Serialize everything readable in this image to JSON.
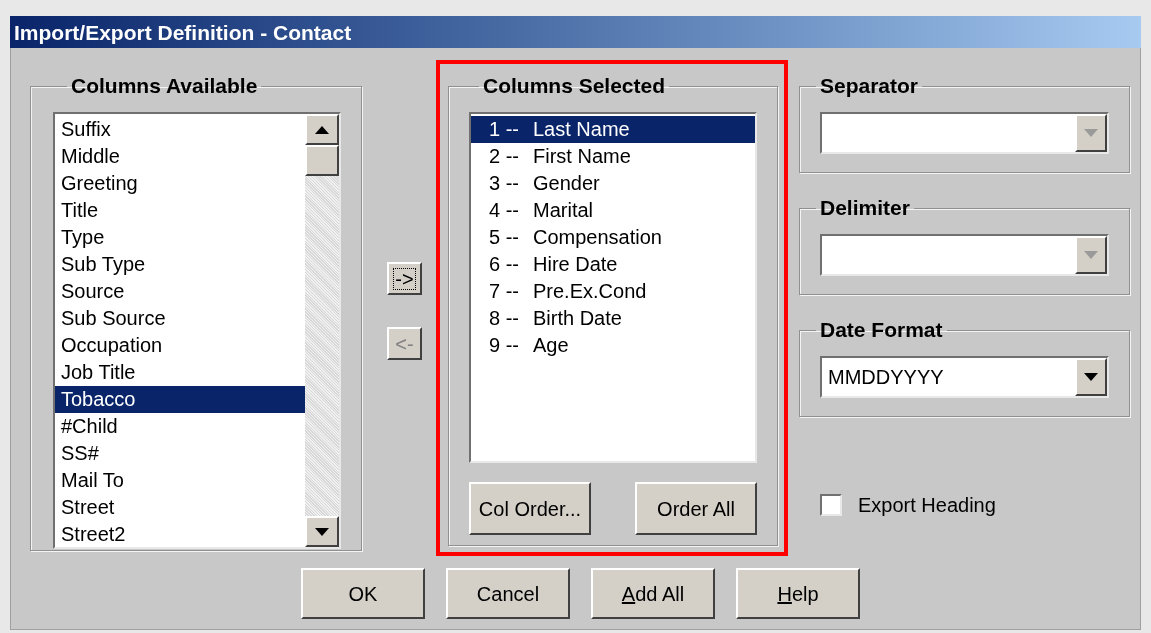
{
  "window": {
    "title": "Import/Export Definition - Contact"
  },
  "columns_available": {
    "title": "Columns Available",
    "items": [
      {
        "label": "Suffix",
        "selected": false
      },
      {
        "label": "Middle",
        "selected": false
      },
      {
        "label": "Greeting",
        "selected": false
      },
      {
        "label": "Title",
        "selected": false
      },
      {
        "label": "Type",
        "selected": false
      },
      {
        "label": "Sub Type",
        "selected": false
      },
      {
        "label": "Source",
        "selected": false
      },
      {
        "label": "Sub Source",
        "selected": false
      },
      {
        "label": "Occupation",
        "selected": false
      },
      {
        "label": "Job Title",
        "selected": false
      },
      {
        "label": "Tobacco",
        "selected": true
      },
      {
        "label": "#Child",
        "selected": false
      },
      {
        "label": "SS#",
        "selected": false
      },
      {
        "label": "Mail To",
        "selected": false
      },
      {
        "label": "Street",
        "selected": false
      },
      {
        "label": "Street2",
        "selected": false
      }
    ]
  },
  "move_buttons": [
    {
      "label": "->",
      "disabled": false,
      "focused": true
    },
    {
      "label": "<-",
      "disabled": true,
      "focused": false
    }
  ],
  "columns_selected": {
    "title": "Columns Selected",
    "highlighted": true,
    "items": [
      {
        "number": "1 --",
        "label": "Last Name",
        "selected": true
      },
      {
        "number": "2 --",
        "label": "First Name",
        "selected": false
      },
      {
        "number": "3 --",
        "label": "Gender",
        "selected": false
      },
      {
        "number": "4 --",
        "label": "Marital",
        "selected": false
      },
      {
        "number": "5 --",
        "label": "Compensation",
        "selected": false
      },
      {
        "number": "6 --",
        "label": "Hire Date",
        "selected": false
      },
      {
        "number": "7 --",
        "label": "Pre.Ex.Cond",
        "selected": false
      },
      {
        "number": "8 --",
        "label": "Birth Date",
        "selected": false
      },
      {
        "number": "9 --",
        "label": "Age",
        "selected": false
      }
    ],
    "buttons": [
      "Col Order...",
      "Order All"
    ]
  },
  "dropdowns": [
    {
      "title": "Separator",
      "disabled": true
    },
    {
      "title": "Delimiter",
      "disabled": true
    },
    {
      "title": "Date Format",
      "value": "MMDDYYYY",
      "disabled": false
    }
  ],
  "export_heading": {
    "label": "Export Heading",
    "checked": false
  },
  "buttons": [
    {
      "label": "OK",
      "underline_first": false
    },
    {
      "label": "Cancel",
      "underline_first": false
    },
    {
      "label": "Add All",
      "underline_first": true
    },
    {
      "label": "Help",
      "underline_first": true
    }
  ]
}
